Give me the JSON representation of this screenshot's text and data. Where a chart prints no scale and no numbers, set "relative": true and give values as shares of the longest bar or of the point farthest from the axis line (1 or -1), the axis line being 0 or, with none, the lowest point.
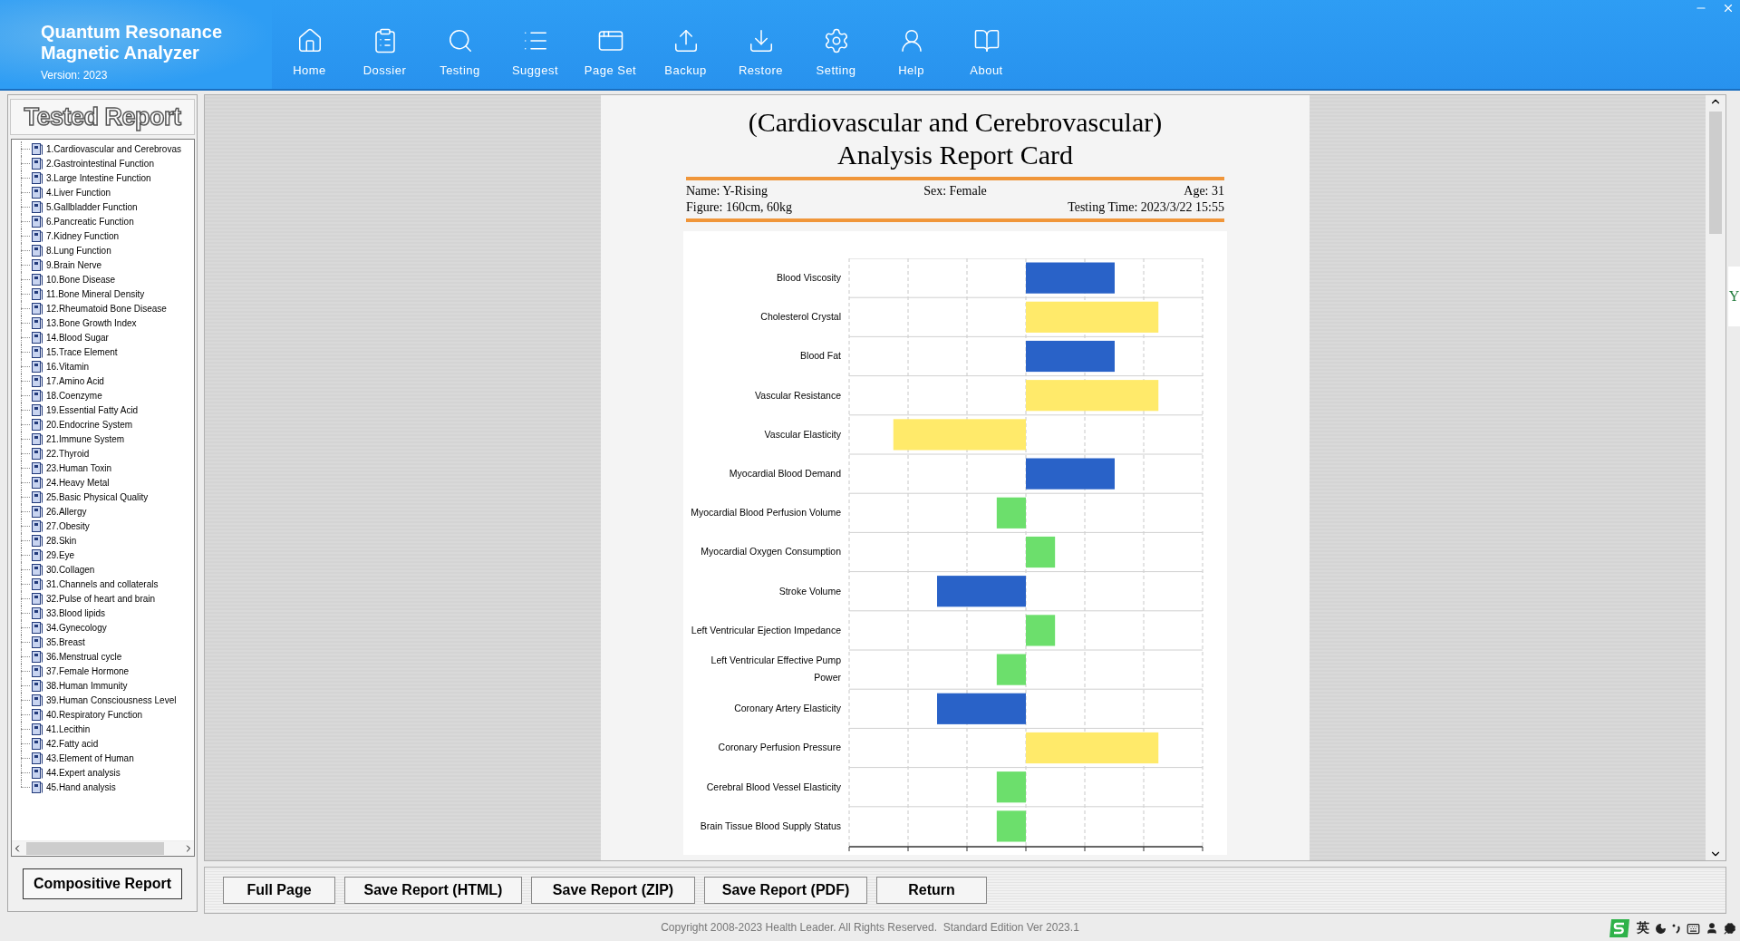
{
  "app": {
    "title_lines": [
      "Quantum Resonance",
      "Magnetic Analyzer"
    ],
    "version": "Version: 2023"
  },
  "window_controls": [
    {
      "kind": "minimize"
    },
    {
      "kind": "close"
    }
  ],
  "toolbar": [
    {
      "label": "Home"
    },
    {
      "label": "Dossier"
    },
    {
      "label": "Testing"
    },
    {
      "label": "Suggest"
    },
    {
      "label": "Page Set"
    },
    {
      "label": "Backup"
    },
    {
      "label": "Restore"
    },
    {
      "label": "Setting"
    },
    {
      "label": "Help"
    },
    {
      "label": "About"
    }
  ],
  "sidebar": {
    "title": "Tested Report",
    "items": [
      "1.Cardiovascular and Cerebrovas",
      "2.Gastrointestinal Function",
      "3.Large Intestine Function",
      "4.Liver Function",
      "5.Gallbladder Function",
      "6.Pancreatic Function",
      "7.Kidney Function",
      "8.Lung Function",
      "9.Brain Nerve",
      "10.Bone Disease",
      "11.Bone Mineral Density",
      "12.Rheumatoid Bone Disease",
      "13.Bone Growth Index",
      "14.Blood Sugar",
      "15.Trace Element",
      "16.Vitamin",
      "17.Amino Acid",
      "18.Coenzyme",
      "19.Essential Fatty Acid",
      "20.Endocrine System",
      "21.Immune System",
      "22.Thyroid",
      "23.Human Toxin",
      "24.Heavy Metal",
      "25.Basic Physical Quality",
      "26.Allergy",
      "27.Obesity",
      "28.Skin",
      "29.Eye",
      "30.Collagen",
      "31.Channels and collaterals",
      "32.Pulse of heart and brain",
      "33.Blood lipids",
      "34.Gynecology",
      "35.Breast",
      "36.Menstrual cycle",
      "37.Female Hormone",
      "38.Human Immunity",
      "39.Human Consciousness Level",
      "40.Respiratory Function",
      "41.Lecithin",
      "42.Fatty acid",
      "43.Element of Human",
      "44.Expert analysis",
      "45.Hand analysis"
    ],
    "button": "Compositive Report"
  },
  "report": {
    "title_lines": [
      "(Cardiovascular and Cerebrovascular)",
      "Analysis Report Card"
    ],
    "name": "Name: Y-Rising",
    "sex": "Sex: Female",
    "age": "Age: 31",
    "figure": "Figure: 160cm, 60kg",
    "testing_time": "Testing Time: 2023/3/22 15:55",
    "chart_data": {
      "type": "bar",
      "orientation": "horizontal",
      "stacked": true,
      "relative": true,
      "categories": [
        "Blood Viscosity",
        "Cholesterol Crystal",
        "Blood Fat",
        "Vascular Resistance",
        "Vascular Elasticity",
        "Myocardial Blood Demand",
        "Myocardial Blood Perfusion Volume",
        "Myocardial Oxygen Consumption",
        "Stroke Volume",
        "Left Ventricular Ejection Impedance",
        "Left Ventricular Effective Pump Power",
        "Coronary Artery Elasticity",
        "Coronary Perfusion Pressure",
        "Cerebral Blood Vessel Elasticity",
        "Brain Tissue Blood Supply Status"
      ],
      "series": [
        {
          "color": "#2962c8",
          "values": [
            0.67,
            null,
            0.67,
            null,
            null,
            0.67,
            null,
            null,
            -0.67,
            null,
            null,
            -0.67,
            null,
            null,
            null
          ]
        },
        {
          "color": "#ffea6a",
          "values": [
            null,
            1,
            null,
            1,
            -1,
            null,
            null,
            null,
            null,
            null,
            null,
            null,
            1,
            null,
            null
          ]
        },
        {
          "color": "#6cdf6c",
          "values": [
            null,
            null,
            null,
            null,
            null,
            null,
            -0.22,
            0.22,
            null,
            0.22,
            -0.22,
            null,
            null,
            -0.22,
            -0.22
          ]
        }
      ]
    }
  },
  "side_tab": "Y",
  "buttons": [
    "Full Page",
    "Save Report (HTML)",
    "Save Report (ZIP)",
    "Save Report (PDF)",
    "Return"
  ],
  "status_bar": {
    "copyright": "Copyright 2008-2023 Health Leader. All Rights Reserved.  Standard Edition Ver 2023.1",
    "ime_language": "英"
  }
}
